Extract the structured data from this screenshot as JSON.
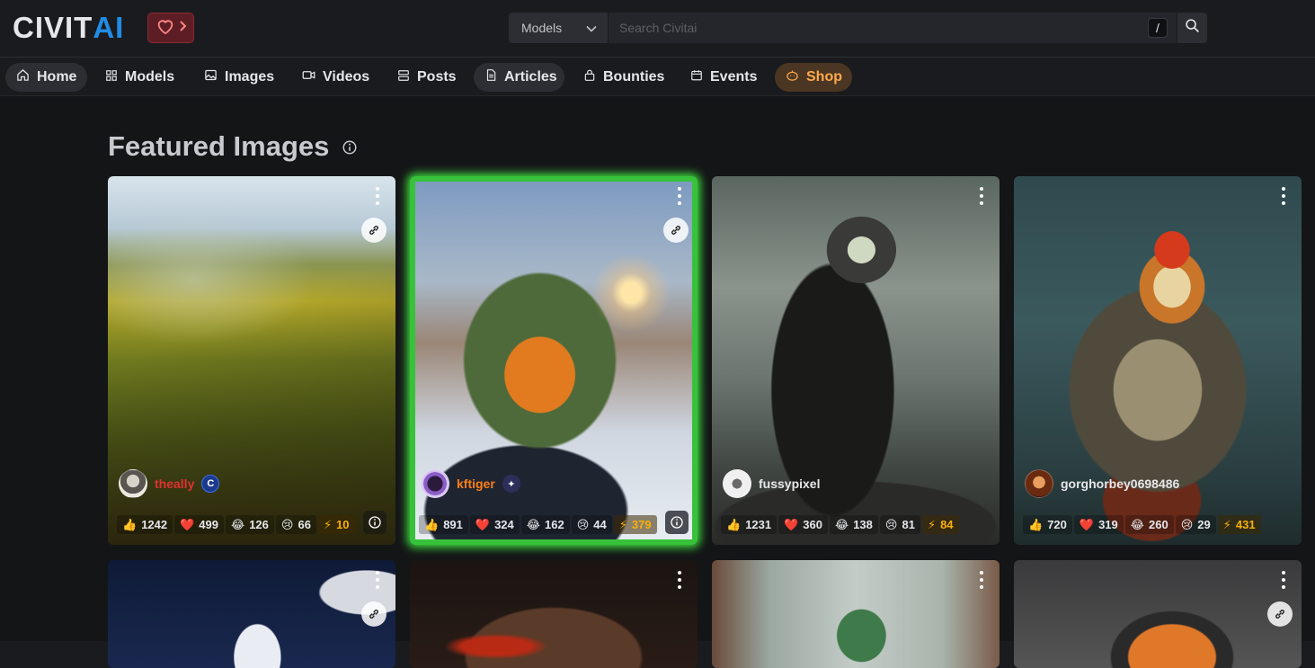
{
  "header": {
    "logo_civ": "CIVIT",
    "logo_ai": "AI",
    "support_icon": "heart-icon",
    "search": {
      "type_label": "Models",
      "placeholder": "Search Civitai",
      "shortcut": "/"
    }
  },
  "nav": {
    "items": [
      {
        "label": "Home",
        "icon": "home-icon"
      },
      {
        "label": "Models",
        "icon": "grid-icon"
      },
      {
        "label": "Images",
        "icon": "photo-icon"
      },
      {
        "label": "Videos",
        "icon": "video-icon"
      },
      {
        "label": "Posts",
        "icon": "layout-list-icon"
      },
      {
        "label": "Articles",
        "icon": "file-text-icon"
      },
      {
        "label": "Bounties",
        "icon": "lock-icon"
      },
      {
        "label": "Events",
        "icon": "calendar-icon"
      },
      {
        "label": "Shop",
        "icon": "pumpkin-icon"
      }
    ],
    "active": "Home"
  },
  "featured": {
    "title": "Featured Images",
    "cards": [
      {
        "user": "theally",
        "user_color": "#e03131",
        "likes": "1242",
        "hearts": "499",
        "laughs": "126",
        "cries": "66",
        "buzz": "10"
      },
      {
        "user": "kftiger",
        "user_color": "#fd7e14",
        "likes": "891",
        "hearts": "324",
        "laughs": "162",
        "cries": "44",
        "buzz": "379"
      },
      {
        "user": "fussypixel",
        "user_color": "#e6e7ea",
        "likes": "1231",
        "hearts": "360",
        "laughs": "138",
        "cries": "81",
        "buzz": "84"
      },
      {
        "user": "gorghorbey0698486",
        "user_color": "#e6e7ea",
        "likes": "720",
        "hearts": "319",
        "laughs": "260",
        "cries": "29",
        "buzz": "431"
      }
    ]
  },
  "colors": {
    "accent": "#228be6",
    "featured_border": "#38c23c",
    "buzz": "#fab005",
    "shop": "#ffa94d"
  }
}
